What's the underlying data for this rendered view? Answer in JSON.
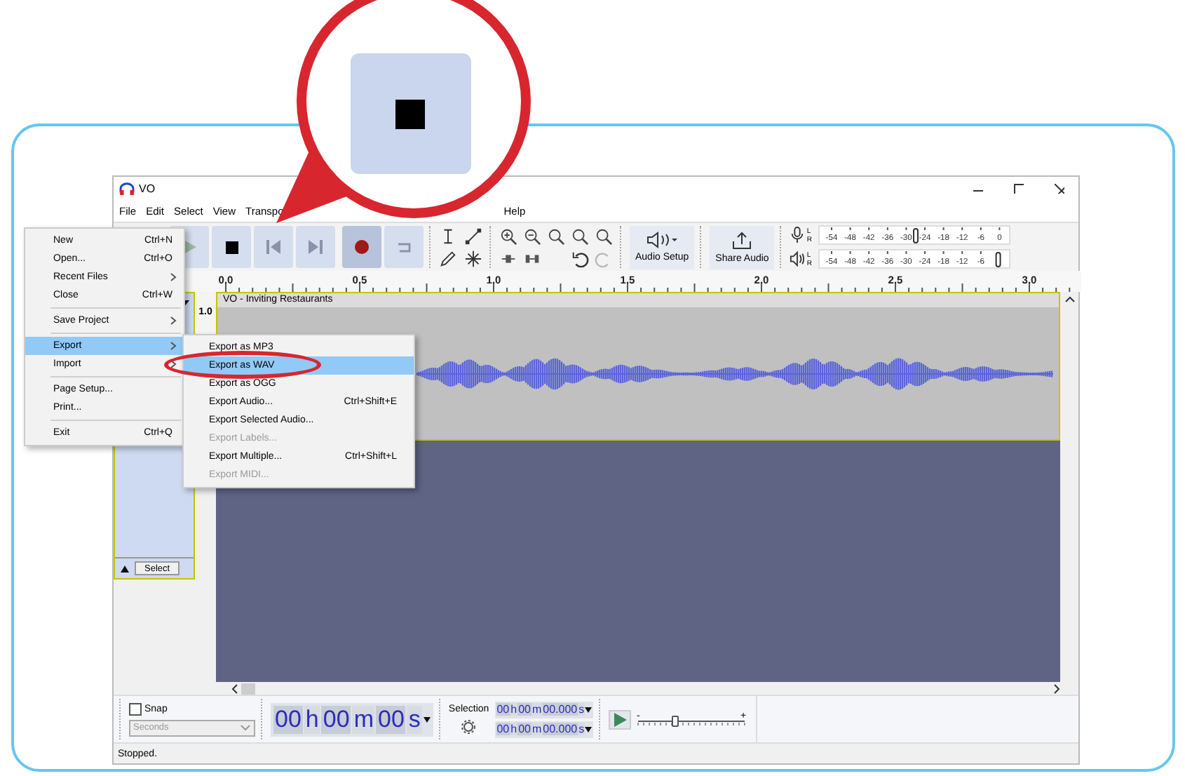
{
  "window": {
    "title": "VO"
  },
  "menu_bar": [
    "File",
    "Edit",
    "Select",
    "View",
    "Transpo",
    "Help"
  ],
  "transport": [
    {
      "kind": "play"
    },
    {
      "kind": "stop"
    },
    {
      "kind": "skip_start"
    },
    {
      "kind": "skip_end"
    },
    {
      "kind": "record"
    },
    {
      "kind": "loop"
    }
  ],
  "audio_setup": "Audio Setup",
  "share_audio": "Share Audio",
  "meters": [
    {
      "kind": "record",
      "channels": [
        "L",
        "R"
      ],
      "ticks": [
        "-54",
        "-48",
        "-42",
        "-36",
        "-30",
        "-24",
        "-18",
        "-12",
        "-6",
        "0"
      ],
      "level": 0.5
    },
    {
      "kind": "playback",
      "channels": [
        "L",
        "R"
      ],
      "ticks": [
        "-54",
        "-48",
        "-42",
        "-36",
        "-30",
        "-24",
        "-18",
        "-12",
        "-6"
      ],
      "level": 0.99
    }
  ],
  "ruler": [
    "0.0",
    "0.5",
    "1.0",
    "1.5",
    "2.0",
    "2.5",
    "3.0"
  ],
  "track": {
    "name": "VO - Inviting Restaurants",
    "scale": "1.0",
    "select_button": "Select"
  },
  "snap": {
    "label": "Snap",
    "checked": false,
    "unit": "Seconds"
  },
  "time": [
    "00",
    "h",
    "00",
    "m",
    "00",
    "s"
  ],
  "selection": {
    "label": "Selection",
    "start": [
      "00",
      "h",
      "00",
      "m",
      "00.000",
      "s"
    ],
    "end": [
      "00",
      "h",
      "00",
      "m",
      "00.000",
      "s"
    ]
  },
  "play_speed": {
    "min_label": "-",
    "max_label": "+",
    "level": 0.36
  },
  "status": "Stopped.",
  "file_menu": [
    {
      "kind": "item",
      "label": "New",
      "shortcut": "Ctrl+N",
      "submenu": false,
      "selected": false
    },
    {
      "kind": "item",
      "label": "Open...",
      "shortcut": "Ctrl+O",
      "submenu": false,
      "selected": false
    },
    {
      "kind": "item",
      "label": "Recent Files",
      "submenu": true,
      "selected": false
    },
    {
      "kind": "item",
      "label": "Close",
      "shortcut": "Ctrl+W",
      "submenu": false,
      "selected": false
    },
    {
      "kind": "separator"
    },
    {
      "kind": "item",
      "label": "Save Project",
      "submenu": true,
      "selected": false
    },
    {
      "kind": "separator"
    },
    {
      "kind": "item",
      "label": "Export",
      "submenu": true,
      "selected": true
    },
    {
      "kind": "item",
      "label": "Import",
      "submenu": true,
      "selected": false
    },
    {
      "kind": "separator"
    },
    {
      "kind": "item",
      "label": "Page Setup...",
      "submenu": false,
      "selected": false
    },
    {
      "kind": "item",
      "label": "Print...",
      "submenu": false,
      "selected": false
    },
    {
      "kind": "separator"
    },
    {
      "kind": "item",
      "label": "Exit",
      "shortcut": "Ctrl+Q",
      "submenu": false,
      "selected": false
    }
  ],
  "export_menu": [
    {
      "label": "Export as MP3",
      "disabled": false,
      "selected": false,
      "circled": false
    },
    {
      "label": "Export as WAV",
      "disabled": false,
      "selected": true,
      "circled": true
    },
    {
      "label": "Export as OGG",
      "disabled": false,
      "selected": false,
      "circled": false
    },
    {
      "label": "Export Audio...",
      "shortcut": "Ctrl+Shift+E",
      "disabled": false,
      "selected": false,
      "circled": false
    },
    {
      "label": "Export Selected Audio...",
      "disabled": false,
      "selected": false,
      "circled": false
    },
    {
      "label": "Export Labels...",
      "disabled": true,
      "selected": false,
      "circled": false
    },
    {
      "label": "Export Multiple...",
      "shortcut": "Ctrl+Shift+L",
      "disabled": false,
      "selected": false,
      "circled": false
    },
    {
      "label": "Export MIDI...",
      "disabled": true,
      "selected": false,
      "circled": false
    }
  ]
}
